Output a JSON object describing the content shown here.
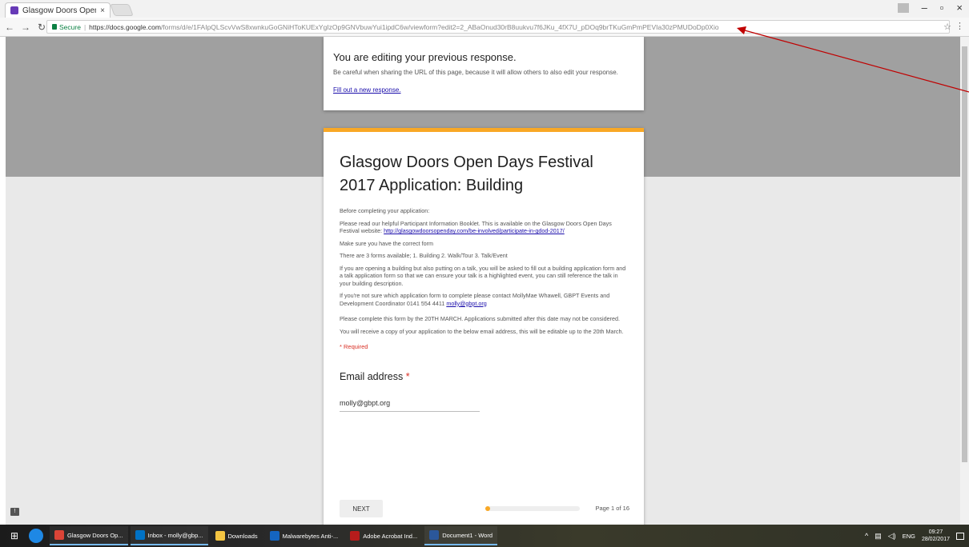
{
  "browser": {
    "tab_title": "Glasgow Doors Open Da",
    "tab_close": "×",
    "window_minimize": "–",
    "window_restore": "▫",
    "window_close": "×",
    "secure_label": "Secure",
    "url_host": "https://docs.google.com",
    "url_path": "/forms/d/e/1FAIpQLScvVwS8xwnkuGoGNiHToKUExYgIzOp9GNVbuwYui1ipdC6w/viewform?edit2=2_ABaOnud30rB8uukvu7f6JKu_4fX7U_pDOq9brTKuGmPmPEVIa30zPMUDoDp0Xio",
    "bookmark_star": "☆",
    "menu": "⋮"
  },
  "notice": {
    "title": "You are editing your previous response.",
    "body": "Be careful when sharing the URL of this page, because it will allow others to also edit your response.",
    "link": "Fill out a new response."
  },
  "form": {
    "title": "Glasgow Doors Open Days Festival 2017 Application: Building",
    "description": {
      "p1": "Before completing your application:",
      "p2_text": "Please read our helpful Participant Information Booklet. This is available on the Glasgow Doors Open Days Festival website: ",
      "p2_link": "http://glasgowdoorsopenday.com/be-involved/participate-in-gdod-2017/",
      "p3": "Make sure you have the correct form",
      "p4": "There are 3 forms available; 1. Building  2. Walk/Tour  3. Talk/Event",
      "p5": "If you are opening a building but also putting on a talk, you will be asked to fill out a building application form and a talk application form so that we can ensure your talk is a highlighted event, you can still reference the talk in your building description.",
      "p6_text": "If you're not sure which application form to complete please contact MollyMae Whawell, GBPT Events and Development Coordinator 0141 554 4411 ",
      "p6_link": "molly@gbpt.org",
      "p7": "Please complete this form by the 20TH MARCH. Applications submitted after this date may not be considered.",
      "p8": "You will receive a copy of your application to the below email address, this will be editable up to the 20th March."
    },
    "required_note": "* Required",
    "email_label": "Email address",
    "email_asterisk": "*",
    "email_value": "molly@gbpt.org",
    "next_label": "NEXT",
    "page_label": "Page 1 of 16",
    "progress_fraction": 0.0625
  },
  "taskbar": {
    "apps": [
      {
        "label": "Glasgow Doors Op...",
        "color": "#db4437"
      },
      {
        "label": "Inbox - molly@gbp...",
        "color": "#0072c6"
      },
      {
        "label": "Downloads",
        "color": "#f4c542"
      },
      {
        "label": "Malwarebytes Anti-...",
        "color": "#1565c0"
      },
      {
        "label": "Adobe Acrobat Ind...",
        "color": "#b71c1c"
      },
      {
        "label": "Document1 - Word",
        "color": "#2b579a"
      }
    ],
    "language": "ENG",
    "time": "09:27",
    "date": "28/02/2017"
  },
  "colors": {
    "accent": "#f9a825",
    "link": "#1a0dab",
    "required": "#d93025",
    "annotation_arrow": "#c00000"
  }
}
